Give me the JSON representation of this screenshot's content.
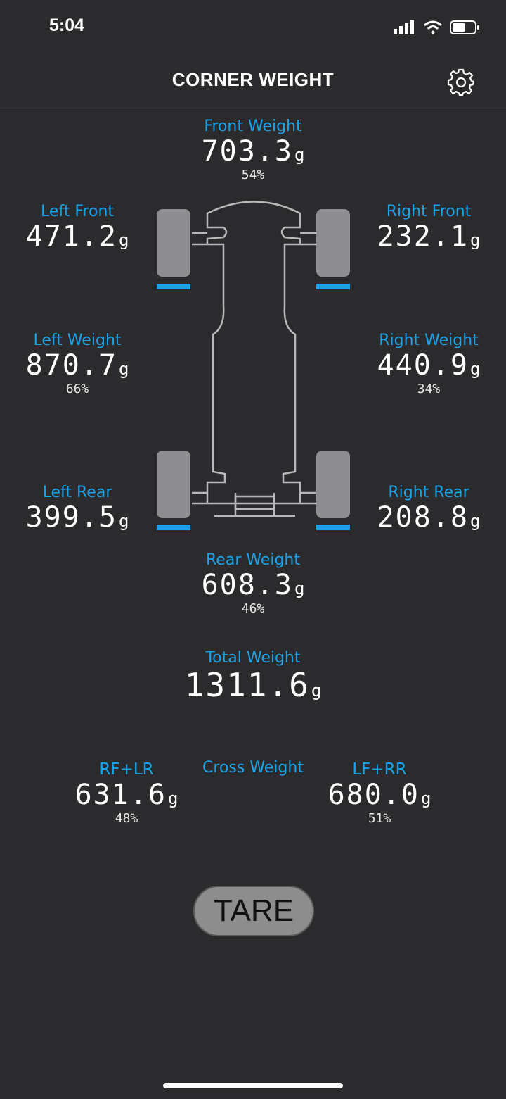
{
  "status_bar": {
    "time": "5:04"
  },
  "header": {
    "title": "CORNER WEIGHT"
  },
  "front": {
    "label": "Front Weight",
    "value": "703.3",
    "unit": "g",
    "percent": "54%"
  },
  "left_front": {
    "label": "Left Front",
    "value": "471.2",
    "unit": "g"
  },
  "right_front": {
    "label": "Right Front",
    "value": "232.1",
    "unit": "g"
  },
  "left_side": {
    "label": "Left Weight",
    "value": "870.7",
    "unit": "g",
    "percent": "66%"
  },
  "right_side": {
    "label": "Right Weight",
    "value": "440.9",
    "unit": "g",
    "percent": "34%"
  },
  "left_rear": {
    "label": "Left Rear",
    "value": "399.5",
    "unit": "g"
  },
  "right_rear": {
    "label": "Right Rear",
    "value": "208.8",
    "unit": "g"
  },
  "rear": {
    "label": "Rear Weight",
    "value": "608.3",
    "unit": "g",
    "percent": "46%"
  },
  "total": {
    "label": "Total Weight",
    "value": "1311.6",
    "unit": "g"
  },
  "cross": {
    "label": "Cross Weight",
    "rf_lr": {
      "label": "RF+LR",
      "value": "631.6",
      "unit": "g",
      "percent": "48%"
    },
    "lf_rr": {
      "label": "LF+RR",
      "value": "680.0",
      "unit": "g",
      "percent": "51%"
    }
  },
  "tare_button": {
    "label": "TARE"
  },
  "colors": {
    "accent": "#1aa3e8",
    "background": "#2b2b2d",
    "tire": "#8e8e90",
    "button": "#8d8d8d"
  }
}
